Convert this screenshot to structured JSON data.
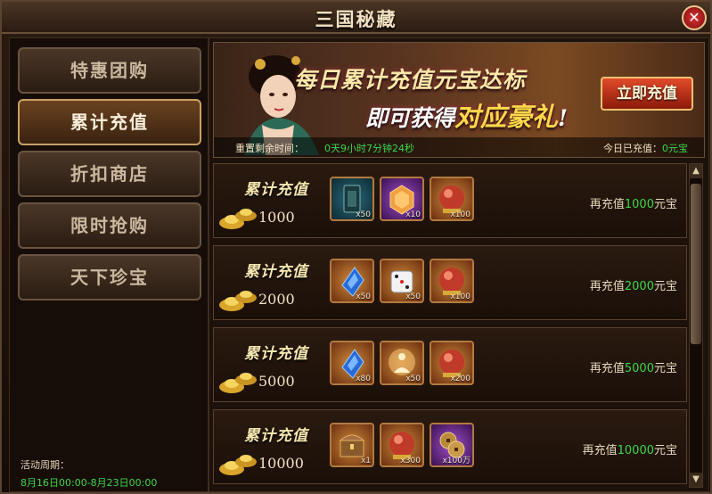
{
  "window": {
    "title": "三国秘藏",
    "close_glyph": "✕"
  },
  "sidebar": {
    "items": [
      {
        "label": "特惠团购",
        "active": false
      },
      {
        "label": "累计充值",
        "active": true
      },
      {
        "label": "折扣商店",
        "active": false
      },
      {
        "label": "限时抢购",
        "active": false
      },
      {
        "label": "天下珍宝",
        "active": false
      }
    ],
    "period_label": "活动周期：",
    "period_value": "8月16日00:00-8月23日00:00"
  },
  "banner": {
    "line1": "每日累计充值元宝达标",
    "line2_prefix": "即可获得",
    "line2_highlight": "对应豪礼",
    "line2_suffix": "!",
    "recharge_button": "立即充值",
    "reset_label": "重置剩余时间：",
    "reset_value": "0天9小时7分钟24秒",
    "today_label": "今日已充值：",
    "today_value": "0元宝"
  },
  "tiers": [
    {
      "title": "累计充值",
      "amount": "1000",
      "items": [
        {
          "icon": "scroll-icon",
          "qty": "x50",
          "color": "blue"
        },
        {
          "icon": "hexagon-gem-icon",
          "qty": "x10",
          "color": "purple"
        },
        {
          "icon": "red-orb-icon",
          "qty": "x100",
          "color": "orange"
        }
      ],
      "needs_prefix": "再充值",
      "needs_num": "1000",
      "needs_suffix": "元宝"
    },
    {
      "title": "累计充值",
      "amount": "2000",
      "items": [
        {
          "icon": "blue-crystal-icon",
          "qty": "x50",
          "color": "orange"
        },
        {
          "icon": "dice-icon",
          "qty": "x50",
          "color": "orange"
        },
        {
          "icon": "red-orb-icon",
          "qty": "x100",
          "color": "orange"
        }
      ],
      "needs_prefix": "再充值",
      "needs_num": "2000",
      "needs_suffix": "元宝"
    },
    {
      "title": "累计充值",
      "amount": "5000",
      "items": [
        {
          "icon": "blue-crystal-icon",
          "qty": "x80",
          "color": "orange"
        },
        {
          "icon": "meditating-figure-icon",
          "qty": "x50",
          "color": "orange"
        },
        {
          "icon": "red-orb-icon",
          "qty": "x200",
          "color": "orange"
        }
      ],
      "needs_prefix": "再充值",
      "needs_num": "5000",
      "needs_suffix": "元宝"
    },
    {
      "title": "累计充值",
      "amount": "10000",
      "items": [
        {
          "icon": "treasure-chest-icon",
          "qty": "x1",
          "color": "orange"
        },
        {
          "icon": "red-orb-icon",
          "qty": "x300",
          "color": "orange"
        },
        {
          "icon": "coins-icon",
          "qty": "x100万",
          "color": "purple"
        }
      ],
      "needs_prefix": "再充值",
      "needs_num": "10000",
      "needs_suffix": "元宝"
    }
  ],
  "scrollbar": {
    "up_glyph": "▲",
    "down_glyph": "▼"
  }
}
